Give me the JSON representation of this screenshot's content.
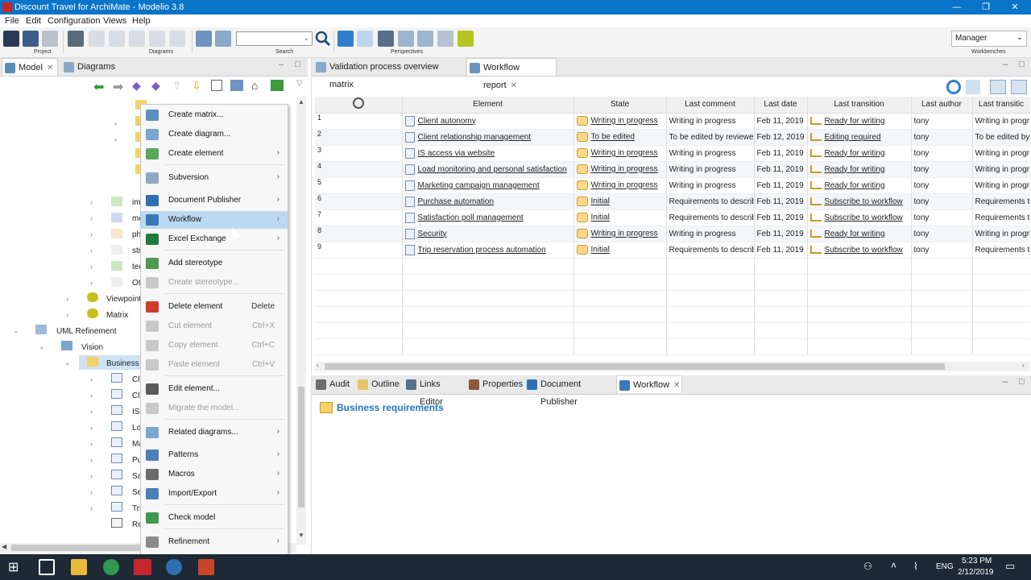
{
  "window": {
    "title": "Discount Travel for ArchiMate - Modelio 3.8",
    "minimize": "—",
    "maximize": "❐",
    "close": "✕"
  },
  "menu": [
    "File",
    "Edit",
    "Configuration",
    "Views",
    "Help"
  ],
  "toolbar": {
    "groups": {
      "project": "Project",
      "diagrams": "Diagrams",
      "search": "Search",
      "perspectives": "Perspectives",
      "workbenches": "Workbenches"
    },
    "workbench_select": "Manager"
  },
  "left_panel": {
    "tabs": [
      {
        "label": "Model"
      },
      {
        "label": "Diagrams"
      }
    ],
    "tree": {
      "partial_items": [
        "im",
        "mo",
        "ph",
        "str",
        "tec",
        "Ot"
      ],
      "viewpoints": "Viewpoints",
      "matrix": "Matrix",
      "uml_refinement": "UML Refinement",
      "vision": "Vision",
      "business": "Business r",
      "children": [
        "Cli",
        "Cli",
        "IS",
        "Lo",
        "Ma",
        "Pu",
        "Sa",
        "Se",
        "Tri",
        "Re"
      ]
    }
  },
  "context_menu": {
    "items": [
      {
        "label": "Create matrix...",
        "shortcut": "",
        "submenu": false,
        "disabled": false,
        "icon": "matrix-icon",
        "color": "#5f8fbf"
      },
      {
        "label": "Create diagram...",
        "shortcut": "",
        "submenu": false,
        "disabled": false,
        "icon": "diagram-icon",
        "color": "#7aa6cf"
      },
      {
        "label": "Create element",
        "shortcut": "",
        "submenu": true,
        "disabled": false,
        "icon": "element-icon",
        "color": "#58a658"
      },
      {
        "label": "Subversion",
        "shortcut": "",
        "submenu": true,
        "disabled": false,
        "icon": "subversion-icon",
        "color": "#8fa8c8"
      },
      {
        "label": "Document Publisher",
        "shortcut": "",
        "submenu": true,
        "disabled": false,
        "icon": "document-publisher-icon",
        "color": "#2e6fb0"
      },
      {
        "label": "Workflow",
        "shortcut": "",
        "submenu": true,
        "disabled": false,
        "icon": "workflow-icon",
        "color": "#3b78b8"
      },
      {
        "label": "Excel Exchange",
        "shortcut": "",
        "submenu": true,
        "disabled": false,
        "icon": "excel-icon",
        "color": "#1f7a3a"
      },
      {
        "label": "Add stereotype",
        "shortcut": "",
        "submenu": false,
        "disabled": false,
        "icon": "add-stereotype-icon",
        "color": "#4f9a4f"
      },
      {
        "label": "Create stereotype...",
        "shortcut": "",
        "submenu": false,
        "disabled": true,
        "icon": "create-stereotype-icon",
        "color": "#c8c8c8"
      },
      {
        "label": "Delete element",
        "shortcut": "Delete",
        "submenu": false,
        "disabled": false,
        "icon": "delete-icon",
        "color": "#d23a2a"
      },
      {
        "label": "Cut element",
        "shortcut": "Ctrl+X",
        "submenu": false,
        "disabled": true,
        "icon": "cut-icon",
        "color": "#c8c8c8"
      },
      {
        "label": "Copy element",
        "shortcut": "Ctrl+C",
        "submenu": false,
        "disabled": true,
        "icon": "copy-icon",
        "color": "#c8c8c8"
      },
      {
        "label": "Paste element",
        "shortcut": "Ctrl+V",
        "submenu": false,
        "disabled": true,
        "icon": "paste-icon",
        "color": "#c8c8c8"
      },
      {
        "label": "Edit element...",
        "shortcut": "",
        "submenu": false,
        "disabled": false,
        "icon": "edit-icon",
        "color": "#5b5b5b"
      },
      {
        "label": "Migrate the model...",
        "shortcut": "",
        "submenu": false,
        "disabled": true,
        "icon": "migrate-icon",
        "color": "#c8c8c8"
      },
      {
        "label": "Related diagrams...",
        "shortcut": "",
        "submenu": true,
        "disabled": false,
        "icon": "related-diagrams-icon",
        "color": "#7aa6cf"
      },
      {
        "label": "Patterns",
        "shortcut": "",
        "submenu": true,
        "disabled": false,
        "icon": "patterns-icon",
        "color": "#4a7fb8"
      },
      {
        "label": "Macros",
        "shortcut": "",
        "submenu": true,
        "disabled": false,
        "icon": "macros-icon",
        "color": "#6b6b6b"
      },
      {
        "label": "Import/Export",
        "shortcut": "",
        "submenu": true,
        "disabled": false,
        "icon": "import-export-icon",
        "color": "#4b7fb8"
      },
      {
        "label": "Check model",
        "shortcut": "",
        "submenu": false,
        "disabled": false,
        "icon": "check-model-icon",
        "color": "#3f9a4f"
      },
      {
        "label": "Refinement",
        "shortcut": "",
        "submenu": true,
        "disabled": false,
        "icon": "refinement-icon",
        "color": "#8a8a8a"
      }
    ]
  },
  "editor": {
    "tabs": [
      {
        "label": "Validation process overview matrix"
      },
      {
        "label": "Workflow report"
      }
    ],
    "columns": [
      "Element",
      "State",
      "Last comment",
      "Last date",
      "Last transition",
      "Last author",
      "Last transitic"
    ],
    "rows": [
      {
        "n": "1",
        "element": "Client autonomy",
        "state": "Writing in progress",
        "comment": "Writing in progress",
        "date": "Feb 11, 2019",
        "transition": "Ready for writing",
        "author": "tony",
        "last": "Writing in progr"
      },
      {
        "n": "2",
        "element": "Client relationship management",
        "state": "To be edited",
        "comment": "To be edited by reviewer",
        "date": "Feb 12, 2019",
        "transition": "Editing required",
        "author": "tony",
        "last": "To be edited by"
      },
      {
        "n": "3",
        "element": "IS access via website",
        "state": "Writing in progress",
        "comment": "Writing in progress",
        "date": "Feb 11, 2019",
        "transition": "Ready for writing",
        "author": "tony",
        "last": "Writing in progr"
      },
      {
        "n": "4",
        "element": "Load monitoring and personal satisfaction",
        "state": "Writing in progress",
        "comment": "Writing in progress",
        "date": "Feb 11, 2019",
        "transition": "Ready for writing",
        "author": "tony",
        "last": "Writing in progr"
      },
      {
        "n": "5",
        "element": "Marketing campaign management",
        "state": "Writing in progress",
        "comment": "Writing in progress",
        "date": "Feb 11, 2019",
        "transition": "Ready for writing",
        "author": "tony",
        "last": "Writing in progr"
      },
      {
        "n": "6",
        "element": "Purchase automation",
        "state": "Initial",
        "comment": "Requirements to describe",
        "date": "Feb 11, 2019",
        "transition": "Subscribe to workflow",
        "author": "tony",
        "last": "Requirements to"
      },
      {
        "n": "7",
        "element": "Satisfaction poll management",
        "state": "Initial",
        "comment": "Requirements to describe",
        "date": "Feb 11, 2019",
        "transition": "Subscribe to workflow",
        "author": "tony",
        "last": "Requirements to"
      },
      {
        "n": "8",
        "element": "Security",
        "state": "Writing in progress",
        "comment": "Writing in progress",
        "date": "Feb 11, 2019",
        "transition": "Ready for writing",
        "author": "tony",
        "last": "Writing in progr"
      },
      {
        "n": "9",
        "element": "Trip reservation process automation",
        "state": "Initial",
        "comment": "Requirements to describe",
        "date": "Feb 11, 2019",
        "transition": "Subscribe to workflow",
        "author": "tony",
        "last": "Requirements to"
      }
    ]
  },
  "bottom_panel": {
    "tabs": [
      {
        "label": "Audit"
      },
      {
        "label": "Outline"
      },
      {
        "label": "Links Editor"
      },
      {
        "label": "Properties"
      },
      {
        "label": "Document Publisher"
      },
      {
        "label": "Workflow"
      }
    ],
    "heading": "Business requirements"
  },
  "taskbar": {
    "lang": "ENG",
    "time": "5:23 PM",
    "date": "2/12/2019"
  }
}
